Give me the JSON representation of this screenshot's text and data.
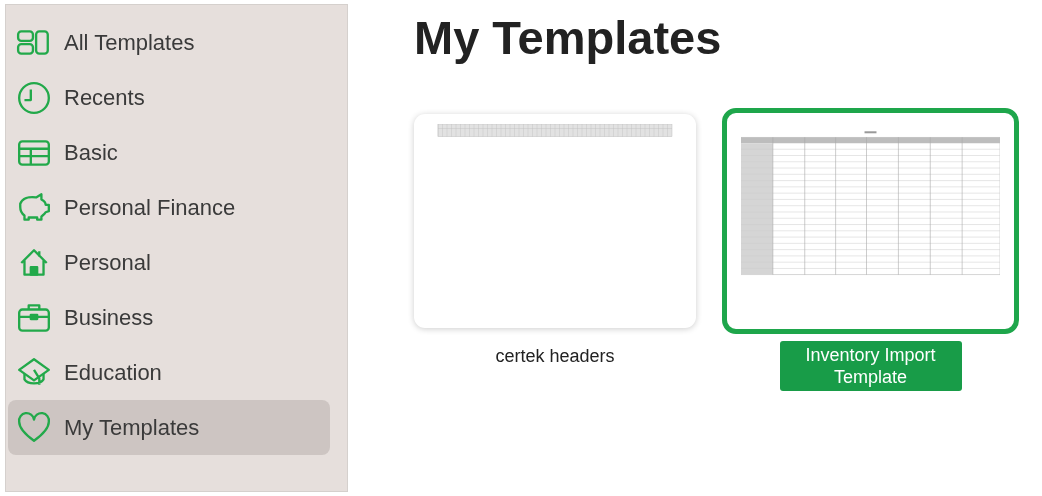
{
  "sidebar": {
    "items": [
      {
        "label": "All Templates",
        "kind": "grid",
        "selected": false
      },
      {
        "label": "Recents",
        "kind": "clock",
        "selected": false
      },
      {
        "label": "Basic",
        "kind": "table",
        "selected": false
      },
      {
        "label": "Personal Finance",
        "kind": "piggy",
        "selected": false
      },
      {
        "label": "Personal",
        "kind": "house",
        "selected": false
      },
      {
        "label": "Business",
        "kind": "briefcase",
        "selected": false
      },
      {
        "label": "Education",
        "kind": "cap",
        "selected": false
      },
      {
        "label": "My Templates",
        "kind": "heart",
        "selected": true
      }
    ]
  },
  "main": {
    "title": "My Templates",
    "templates": [
      {
        "name": "certek headers",
        "kind": "header-strip",
        "selected": false
      },
      {
        "name": "Inventory Import Template",
        "kind": "table-grid",
        "selected": true
      }
    ]
  }
}
